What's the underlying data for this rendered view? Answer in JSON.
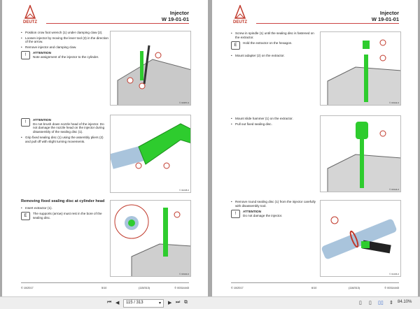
{
  "pages": [
    {
      "title": "Injector",
      "code": "W 19-01-01",
      "logo": "DEUTZ",
      "steps1": [
        "Position crow foot wrench (1) under clamping claw (2).",
        "Loosen injector by moving the lever tool (3) in the direction of the arrow.",
        "Remove injector and clamping claw."
      ],
      "att1": {
        "head": "ATTENTION",
        "text": "Note assignment of the injector to the cylinder."
      },
      "att2": {
        "head": "ATTENTION",
        "text": "Do not brush down nozzle head of the injector. Do not damage the nozzle head on the injector during disassembly of the sealing disc (1)."
      },
      "steps2": [
        "Grip fixed sealing disc (1) using the assembly pliers (2) and pull off with slight turning movements."
      ],
      "heading3": "Removing fixed sealing disc at cylinder head",
      "steps3": [
        "Insert extractor (1)."
      ],
      "note3": "The supports (arrow) must rest in the bore of the sealing disc.",
      "figs": [
        "© 31957-0",
        "© 34238-0",
        "© 31940-0"
      ],
      "callouts": [
        "1",
        "2",
        "3"
      ],
      "footer": {
        "left": "© 10/2017",
        "mid": "5/10",
        "pages": "(115/313)",
        "right": "© 00314443"
      }
    },
    {
      "title": "Injector",
      "code": "W 19-01-01",
      "logo": "DEUTZ",
      "steps1": [
        "Screw in spindle (1) until the sealing disc is fastened on the extractor."
      ],
      "note1": "Hold the extractor on the hexagon.",
      "steps1b": [
        "Mount adapter (2) on the extractor."
      ],
      "steps2": [
        "Mount slide hammer (1) on the extractor.",
        "Pull out fixed sealing disc."
      ],
      "steps3": [
        "Remove round sealing disc (1) from the injector carefully with disassembly tool."
      ],
      "att3": {
        "head": "ATTENTION",
        "text": "Do not damage the injector."
      },
      "figs": [
        "© 31942-0",
        "© 31944-0",
        "© 31436-0"
      ],
      "callouts": [
        "1",
        "2"
      ],
      "footer": {
        "left": "© 10/2017",
        "mid": "6/10",
        "pages": "(116/313)",
        "right": "© 00314443"
      }
    }
  ],
  "toolbar": {
    "page_value": "115 / 313",
    "zoom": "84.10%"
  },
  "colors": {
    "green": "#2ecc2e",
    "red": "#c0392b"
  }
}
